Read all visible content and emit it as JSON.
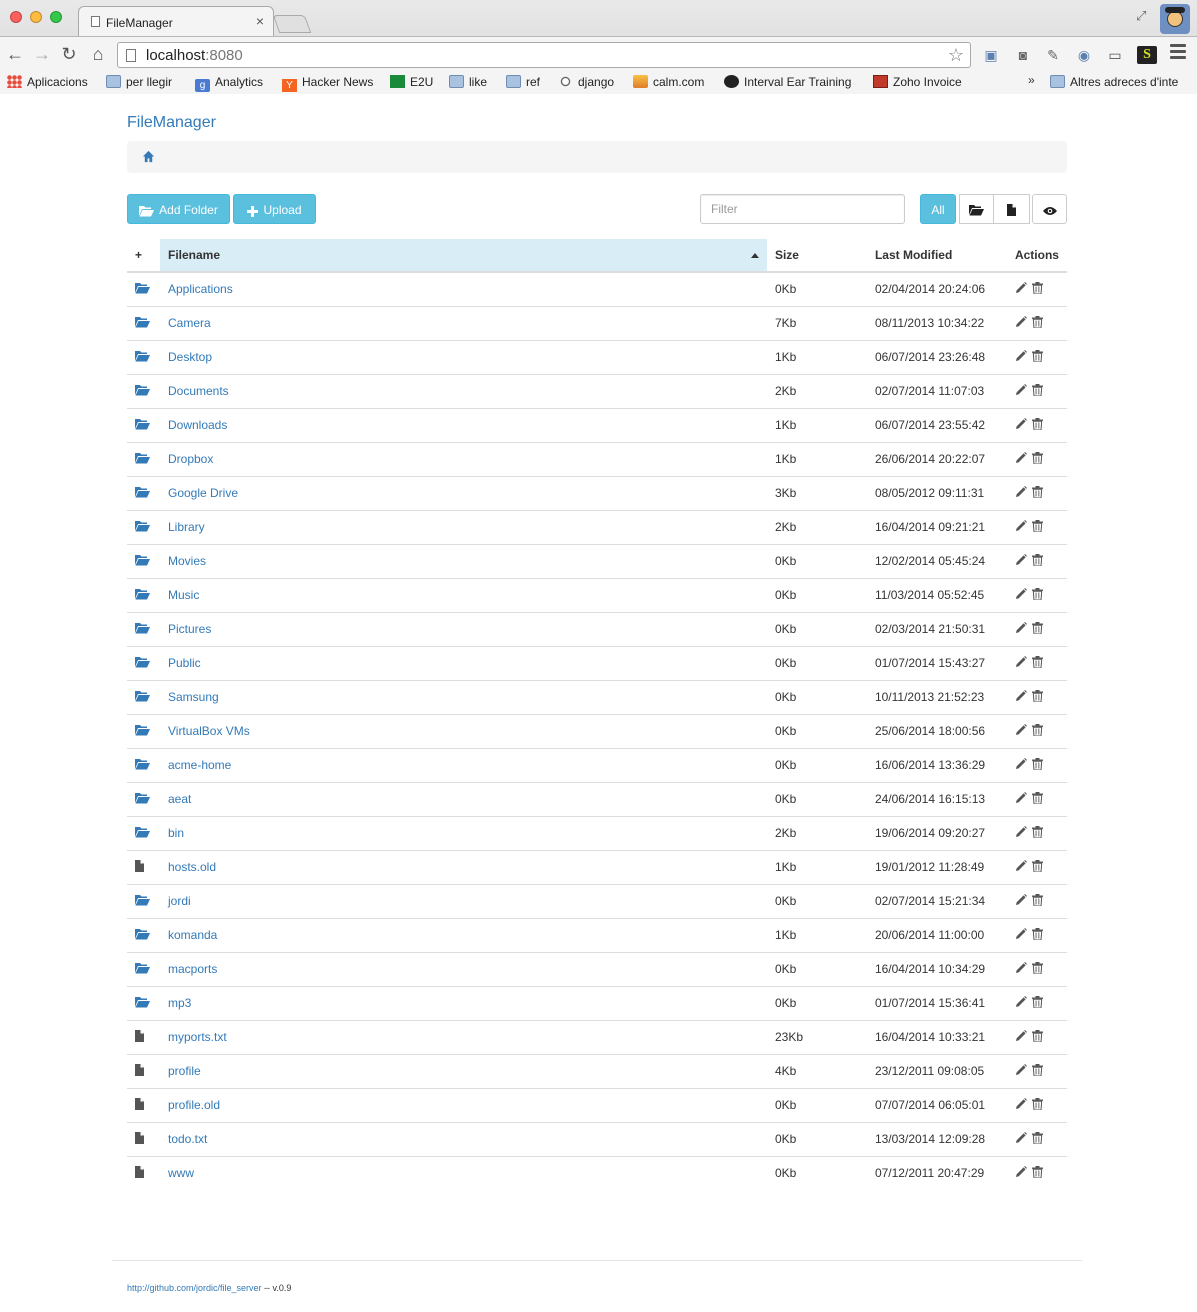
{
  "browser": {
    "tab_title": "FileManager",
    "tab_close": "×",
    "url_host": "localhost",
    "url_port": ":8080",
    "bookmarks": [
      {
        "label": "Aplicacions",
        "icon": "apps-grid-icon"
      },
      {
        "label": "per llegir",
        "icon": "folder-icon"
      },
      {
        "label": "Analytics",
        "icon": "google-icon"
      },
      {
        "label": "Hacker News",
        "icon": "ycombinator-icon"
      },
      {
        "label": "E2U",
        "icon": "e2u-icon"
      },
      {
        "label": "like",
        "icon": "folder-icon"
      },
      {
        "label": "ref",
        "icon": "folder-icon"
      },
      {
        "label": "django",
        "icon": "reddit-icon"
      },
      {
        "label": "calm.com",
        "icon": "calm-icon"
      },
      {
        "label": "Interval Ear Training",
        "icon": "music-note-icon"
      },
      {
        "label": "Zoho Invoice",
        "icon": "zoho-icon"
      }
    ],
    "bookmarks_more": "»",
    "other_bookmarks": "Altres adreces d'inte"
  },
  "app": {
    "brand": "FileManager",
    "add_folder_label": "Add Folder",
    "upload_label": "Upload",
    "filter_placeholder": "Filter",
    "all_label": "All"
  },
  "table": {
    "add_col": "+",
    "headers": {
      "filename": "Filename",
      "size": "Size",
      "modified": "Last Modified",
      "actions": "Actions"
    },
    "rows": [
      {
        "type": "folder",
        "name": "Applications",
        "size": "0Kb",
        "modified": "02/04/2014 20:24:06"
      },
      {
        "type": "folder",
        "name": "Camera",
        "size": "7Kb",
        "modified": "08/11/2013 10:34:22"
      },
      {
        "type": "folder",
        "name": "Desktop",
        "size": "1Kb",
        "modified": "06/07/2014 23:26:48"
      },
      {
        "type": "folder",
        "name": "Documents",
        "size": "2Kb",
        "modified": "02/07/2014 11:07:03"
      },
      {
        "type": "folder",
        "name": "Downloads",
        "size": "1Kb",
        "modified": "06/07/2014 23:55:42"
      },
      {
        "type": "folder",
        "name": "Dropbox",
        "size": "1Kb",
        "modified": "26/06/2014 20:22:07"
      },
      {
        "type": "folder",
        "name": "Google Drive",
        "size": "3Kb",
        "modified": "08/05/2012 09:11:31"
      },
      {
        "type": "folder",
        "name": "Library",
        "size": "2Kb",
        "modified": "16/04/2014 09:21:21"
      },
      {
        "type": "folder",
        "name": "Movies",
        "size": "0Kb",
        "modified": "12/02/2014 05:45:24"
      },
      {
        "type": "folder",
        "name": "Music",
        "size": "0Kb",
        "modified": "11/03/2014 05:52:45"
      },
      {
        "type": "folder",
        "name": "Pictures",
        "size": "0Kb",
        "modified": "02/03/2014 21:50:31"
      },
      {
        "type": "folder",
        "name": "Public",
        "size": "0Kb",
        "modified": "01/07/2014 15:43:27"
      },
      {
        "type": "folder",
        "name": "Samsung",
        "size": "0Kb",
        "modified": "10/11/2013 21:52:23"
      },
      {
        "type": "folder",
        "name": "VirtualBox VMs",
        "size": "0Kb",
        "modified": "25/06/2014 18:00:56"
      },
      {
        "type": "folder",
        "name": "acme-home",
        "size": "0Kb",
        "modified": "16/06/2014 13:36:29"
      },
      {
        "type": "folder",
        "name": "aeat",
        "size": "0Kb",
        "modified": "24/06/2014 16:15:13"
      },
      {
        "type": "folder",
        "name": "bin",
        "size": "2Kb",
        "modified": "19/06/2014 09:20:27"
      },
      {
        "type": "file",
        "name": "hosts.old",
        "size": "1Kb",
        "modified": "19/01/2012 11:28:49"
      },
      {
        "type": "folder",
        "name": "jordi",
        "size": "0Kb",
        "modified": "02/07/2014 15:21:34"
      },
      {
        "type": "folder",
        "name": "komanda",
        "size": "1Kb",
        "modified": "20/06/2014 11:00:00"
      },
      {
        "type": "folder",
        "name": "macports",
        "size": "0Kb",
        "modified": "16/04/2014 10:34:29"
      },
      {
        "type": "folder",
        "name": "mp3",
        "size": "0Kb",
        "modified": "01/07/2014 15:36:41"
      },
      {
        "type": "file",
        "name": "myports.txt",
        "size": "23Kb",
        "modified": "16/04/2014 10:33:21"
      },
      {
        "type": "file",
        "name": "profile",
        "size": "4Kb",
        "modified": "23/12/2011 09:08:05"
      },
      {
        "type": "file",
        "name": "profile.old",
        "size": "0Kb",
        "modified": "07/07/2014 06:05:01"
      },
      {
        "type": "file",
        "name": "todo.txt",
        "size": "0Kb",
        "modified": "13/03/2014 12:09:28"
      },
      {
        "type": "file",
        "name": "www",
        "size": "0Kb",
        "modified": "07/12/2011 20:47:29"
      }
    ]
  },
  "footer": {
    "link": "http://github.com/jordic/file_server",
    "version": " -- v.0.9"
  },
  "colors": {
    "link": "#337ab7",
    "info": "#5bc0de",
    "sorted_header": "#d9edf7",
    "folder_icon": "#337ab7",
    "file_icon": "#555555"
  }
}
